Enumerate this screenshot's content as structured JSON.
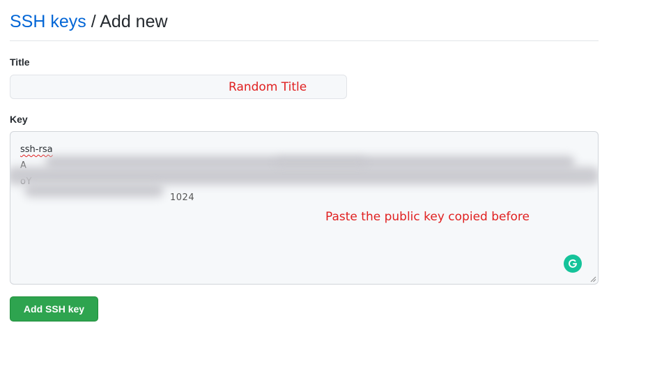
{
  "breadcrumb": {
    "parent_label": "SSH keys",
    "separator": "/",
    "current_label": "Add new"
  },
  "form": {
    "title_label": "Title",
    "title_value": "",
    "key_label": "Key",
    "key_value_prefix": "ssh-rsa",
    "key_value_visible_fragments": [
      "A",
      "oY",
      "MllcyMa",
      "M..5N..MrqHYnRO",
      "RC11",
      "1024"
    ],
    "submit_label": "Add SSH key"
  },
  "annotations": {
    "title_note": "Random Title",
    "key_note": "Paste the public key copied before",
    "color": "#e02020"
  },
  "icons": {
    "grammarly": "grammarly-icon",
    "resize": "resize-handle-icon"
  },
  "colors": {
    "link": "#0366d6",
    "primary_button": "#2ea44f",
    "annotation": "#e02020",
    "grammarly": "#15c39a"
  }
}
